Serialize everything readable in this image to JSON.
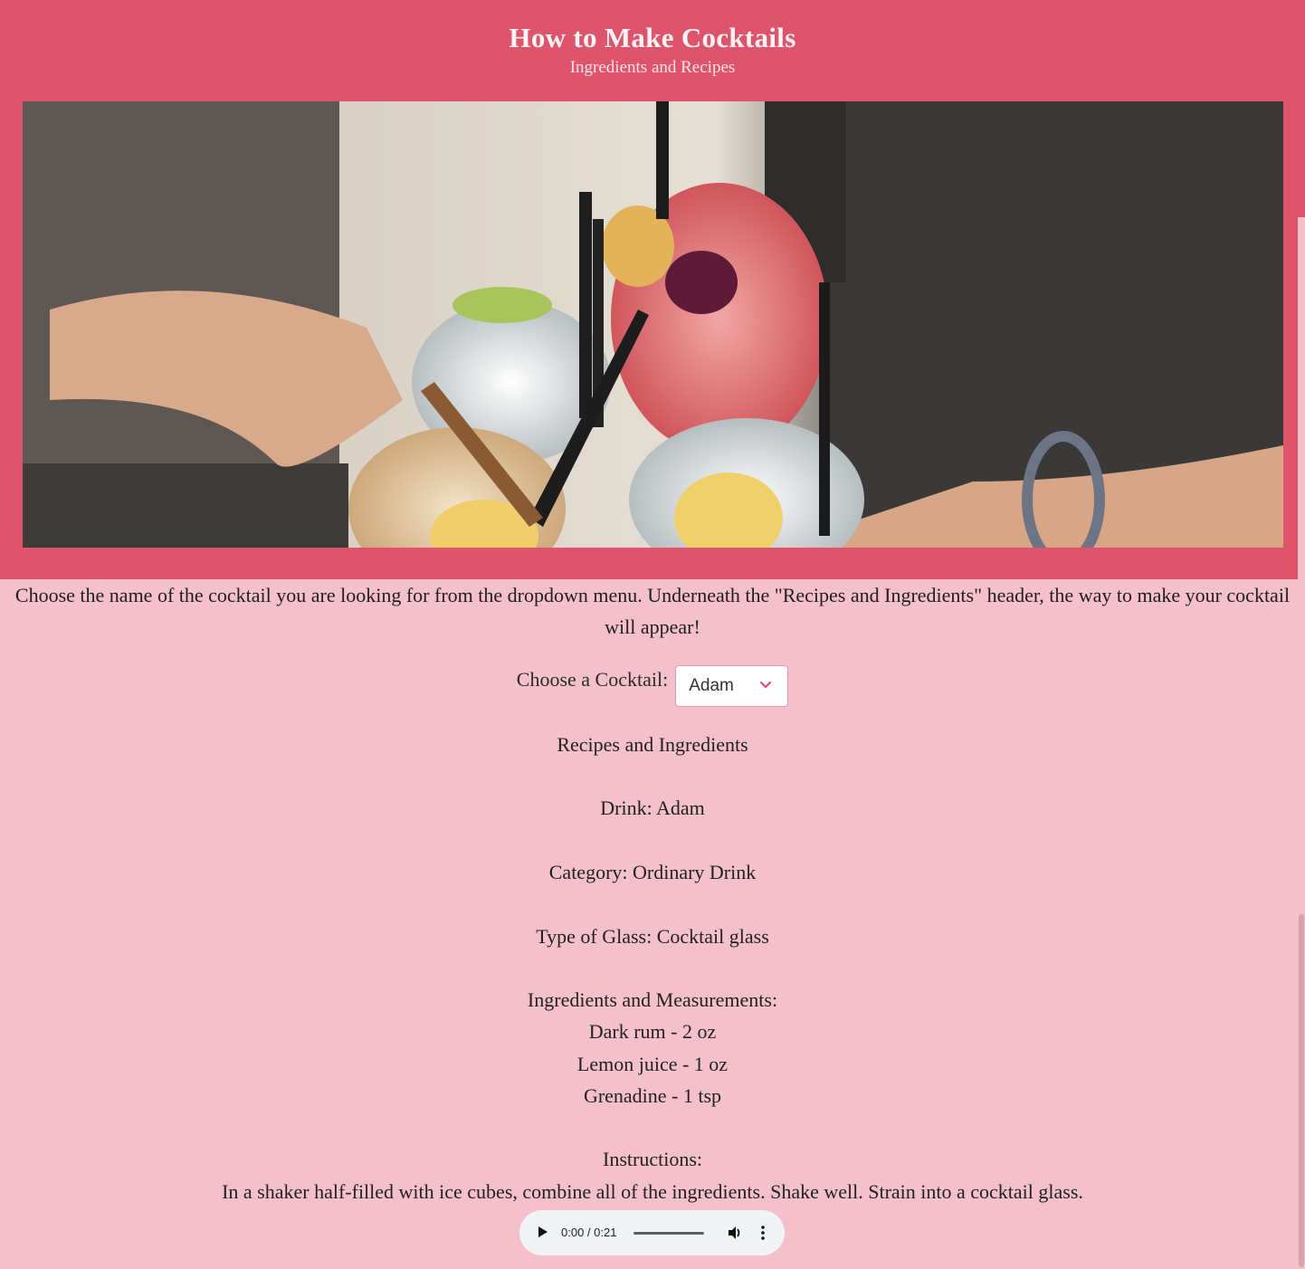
{
  "header": {
    "title": "How to Make Cocktails",
    "subtitle": "Ingredients and Recipes"
  },
  "hero": {
    "alt": "Cocktails toast"
  },
  "intro": {
    "text": "Choose the name of the cocktail you are looking for from the dropdown menu. Underneath the \"Recipes and Ingredients\" header, the way to make your cocktail will appear!"
  },
  "chooser": {
    "label": "Choose a Cocktail:",
    "selected": "Adam"
  },
  "recipe": {
    "heading": "Recipes and Ingredients",
    "drink": "Drink: Adam",
    "category": "Category: Ordinary Drink",
    "glass": "Type of Glass: Cocktail glass",
    "ingredients_heading": "Ingredients and Measurements:",
    "ingredients": [
      "Dark rum - 2 oz",
      "Lemon juice - 1 oz",
      "Grenadine - 1 tsp"
    ],
    "instructions_heading": "Instructions:",
    "instructions": "In a shaker half-filled with ice cubes, combine all of the ingredients. Shake well. Strain into a cocktail glass."
  },
  "audio": {
    "time": "0:00 / 0:21",
    "progress": 0
  },
  "colors": {
    "banner": "#df546d",
    "background": "#f4c0cb",
    "accent": "#e0435f"
  },
  "icons": [
    "chevron-down-icon",
    "play-icon",
    "volume-icon",
    "more-vertical-icon"
  ]
}
